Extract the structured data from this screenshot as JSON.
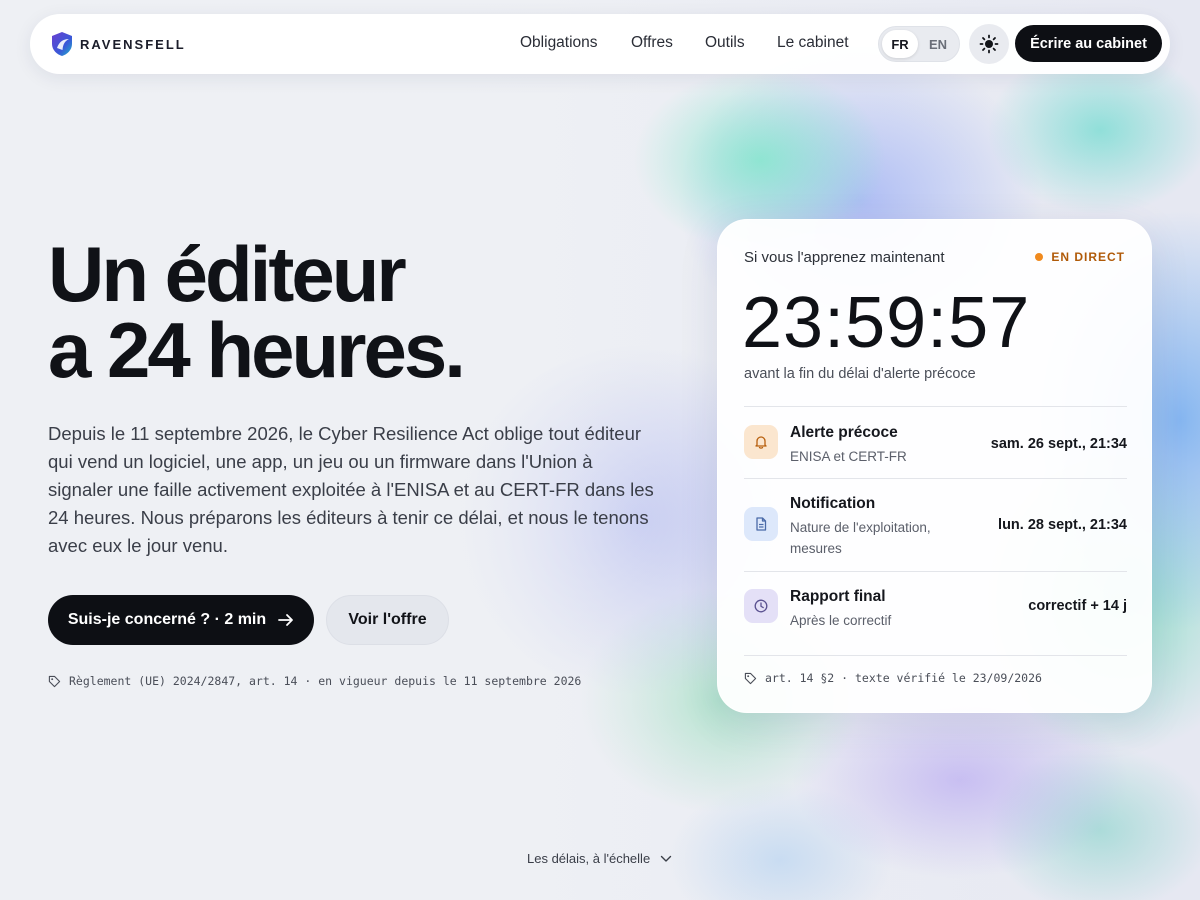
{
  "brand": {
    "name": "RAVENSFELL"
  },
  "nav": {
    "links": [
      "Obligations",
      "Offres",
      "Outils",
      "Le cabinet"
    ],
    "languages": [
      {
        "label": "FR",
        "active": true
      },
      {
        "label": "EN",
        "active": false
      }
    ],
    "theme_icon": "sun-icon",
    "cta": "Écrire au cabinet"
  },
  "hero": {
    "title_line1": "Un éditeur",
    "title_line2": "a 24 heures.",
    "description": "Depuis le 11 septembre 2026, le Cyber Resilience Act oblige tout éditeur qui vend un logiciel, une app, un jeu ou un firmware dans l'Union à signaler une faille activement exploitée à l'ENISA et au CERT-FR dans les 24 heures. Nous préparons les éditeurs à tenir ce délai, et nous le tenons avec eux le jour venu.",
    "primary_button": "Suis-je concerné ? · 2 min",
    "secondary_button": "Voir l'offre",
    "legal_note": "Règlement (UE) 2024/2847, art. 14 · en vigueur depuis le 11 septembre 2026"
  },
  "countdown_card": {
    "heading": "Si vous l'apprenez maintenant",
    "live_label": "EN DIRECT",
    "timer": "23:59:57",
    "timer_caption": "avant la fin du délai d'alerte précoce",
    "rows": [
      {
        "icon": "bell-icon",
        "title": "Alerte précoce",
        "subtitle": "ENISA et CERT-FR",
        "value": "sam. 26 sept., 21:34",
        "icon_bg": "#fbe6cf",
        "icon_color": "#b8600e"
      },
      {
        "icon": "document-icon",
        "title": "Notification",
        "subtitle": "Nature de l'exploitation, mesures",
        "value": "lun. 28 sept., 21:34",
        "icon_bg": "#dde8fb",
        "icon_color": "#4a6aa8"
      },
      {
        "icon": "clock-icon",
        "title": "Rapport final",
        "subtitle": "Après le correctif",
        "value": "correctif + 14 j",
        "icon_bg": "#e4e0f7",
        "icon_color": "#5a5190"
      }
    ],
    "footnote": "art. 14 §2 · texte vérifié le 23/09/2026"
  },
  "scroll_hint": "Les délais, à l'échelle",
  "colors": {
    "primary_dark": "#0d0f14",
    "live_accent": "#f08a1e",
    "page_background": "#eef0f4"
  }
}
